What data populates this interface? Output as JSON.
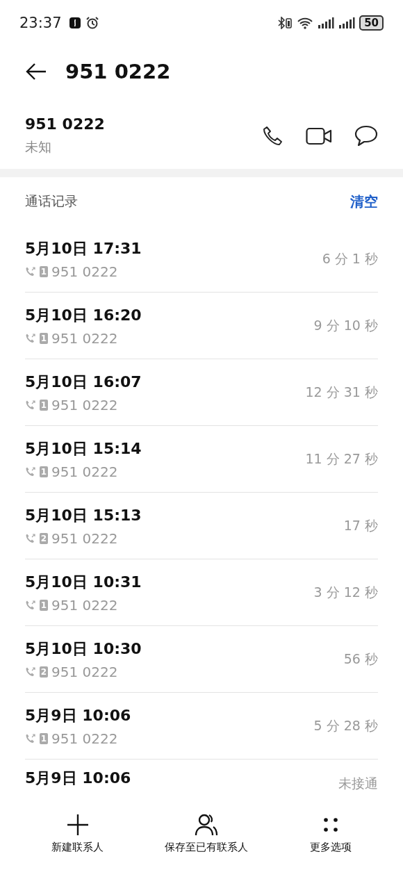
{
  "status_bar": {
    "time": "23:37",
    "battery": "50"
  },
  "header": {
    "title": "951 0222"
  },
  "contact": {
    "number": "951 0222",
    "label": "未知"
  },
  "call_log": {
    "title": "通话记录",
    "clear": "清空",
    "rows": [
      {
        "date": "5月10日 17:31",
        "sim": "1",
        "number": "951 0222",
        "duration": "6 分 1 秒"
      },
      {
        "date": "5月10日 16:20",
        "sim": "1",
        "number": "951 0222",
        "duration": "9 分 10 秒"
      },
      {
        "date": "5月10日 16:07",
        "sim": "1",
        "number": "951 0222",
        "duration": "12 分 31 秒"
      },
      {
        "date": "5月10日 15:14",
        "sim": "1",
        "number": "951 0222",
        "duration": "11 分 27 秒"
      },
      {
        "date": "5月10日 15:13",
        "sim": "2",
        "number": "951 0222",
        "duration": "17 秒"
      },
      {
        "date": "5月10日 10:31",
        "sim": "1",
        "number": "951 0222",
        "duration": "3 分 12 秒"
      },
      {
        "date": "5月10日 10:30",
        "sim": "2",
        "number": "951 0222",
        "duration": "56 秒"
      },
      {
        "date": "5月9日 10:06",
        "sim": "1",
        "number": "951 0222",
        "duration": "5 分 28 秒"
      },
      {
        "date": "5月9日 10:06",
        "duration": "未接通"
      }
    ]
  },
  "bottom_bar": [
    {
      "kind": "add",
      "label": "新建联系人"
    },
    {
      "kind": "person",
      "label": "保存至已有联系人"
    },
    {
      "kind": "more",
      "label": "更多选项"
    }
  ]
}
